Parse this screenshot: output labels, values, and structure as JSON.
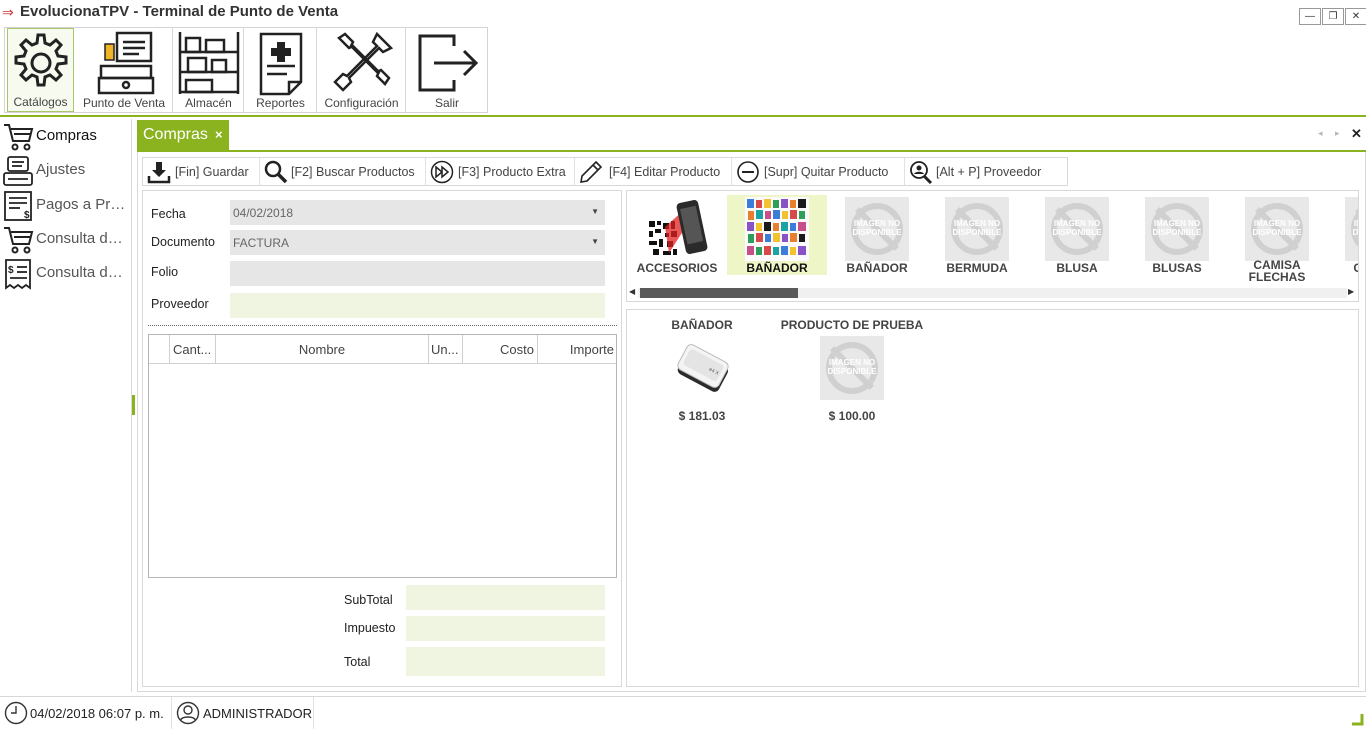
{
  "window": {
    "title": "EvolucionaTPV - Terminal de Punto de Venta",
    "minimize": "—",
    "restore": "❐",
    "close": "✕"
  },
  "ribbon": {
    "items": [
      {
        "label": "Catálogos",
        "icon": "gear-icon"
      },
      {
        "label": "Punto de Venta",
        "icon": "cash-register-icon"
      },
      {
        "label": "Almacén",
        "icon": "shelves-icon"
      },
      {
        "label": "Reportes",
        "icon": "report-icon"
      },
      {
        "label": "Configuración",
        "icon": "tools-icon"
      },
      {
        "label": "Salir",
        "icon": "exit-icon"
      }
    ],
    "active": "Catálogos"
  },
  "sidebar": {
    "items": [
      {
        "label": "Compras",
        "icon": "cart-icon"
      },
      {
        "label": "Ajustes",
        "icon": "adjust-icon"
      },
      {
        "label": "Pagos a Proveedores",
        "icon": "invoice-icon"
      },
      {
        "label": "Consulta de Compras",
        "icon": "cart-icon"
      },
      {
        "label": "Consulta de Pagos",
        "icon": "receipt-icon"
      }
    ],
    "selected": "Compras"
  },
  "tabs": [
    {
      "label": "Compras",
      "close": "×"
    }
  ],
  "tabstrip": {
    "prev": "◂",
    "next": "▸",
    "close": "✕"
  },
  "toolbar": {
    "buttons": [
      {
        "label": "[Fin] Guardar",
        "icon": "download-tray-icon"
      },
      {
        "label": "[F2] Buscar Productos",
        "icon": "magnifier-icon"
      },
      {
        "label": "[F3] Producto Extra",
        "icon": "fast-forward-icon"
      },
      {
        "label": "[F4] Editar Producto",
        "icon": "pencil-icon"
      },
      {
        "label": "[Supr] Quitar Producto",
        "icon": "minus-circle-icon"
      },
      {
        "label": "[Alt + P] Proveedor",
        "icon": "person-search-icon"
      }
    ]
  },
  "form": {
    "fecha": {
      "label": "Fecha",
      "value": "04/02/2018"
    },
    "documento": {
      "label": "Documento",
      "value": "FACTURA"
    },
    "folio": {
      "label": "Folio",
      "value": ""
    },
    "proveedor": {
      "label": "Proveedor",
      "value": ""
    }
  },
  "grid": {
    "columns": [
      "Cant...",
      "Nombre",
      "Un...",
      "Costo",
      "Importe"
    ],
    "rows": []
  },
  "totals": {
    "subtotal": {
      "label": "SubTotal",
      "value": ""
    },
    "impuesto": {
      "label": "Impuesto",
      "value": ""
    },
    "total": {
      "label": "Total",
      "value": ""
    }
  },
  "categories": {
    "items": [
      {
        "label": "ACCESORIOS",
        "image": "phone-qr"
      },
      {
        "label": "BAÑADOR",
        "image": "collage"
      },
      {
        "label": "BAÑADOR",
        "image": "not-available"
      },
      {
        "label": "BERMUDA",
        "image": "not-available"
      },
      {
        "label": "BLUSA",
        "image": "not-available"
      },
      {
        "label": "BLUSAS",
        "image": "not-available"
      },
      {
        "label": "CAMISA FLECHAS",
        "image": "not-available"
      },
      {
        "label": "CAMISA",
        "image": "not-available"
      }
    ],
    "selected_index": 1,
    "placeholder_text": "IMAGEN NO DISPONIBLE"
  },
  "products": [
    {
      "name": "BAÑADOR",
      "price": "$ 181.03",
      "image": "hard-drive"
    },
    {
      "name": "PRODUCTO DE PRUEBA",
      "price": "$ 100.00",
      "image": "not-available"
    }
  ],
  "statusbar": {
    "datetime": "04/02/2018 06:07 p. m.",
    "user": "ADMINISTRADOR"
  },
  "colors": {
    "accent": "#8ab31f",
    "field_green": "#eff5e1",
    "field_gray": "#e6e6e6"
  }
}
